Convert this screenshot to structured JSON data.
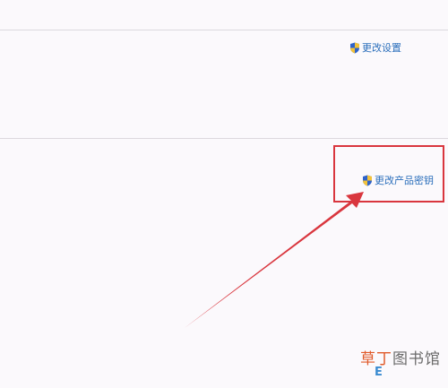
{
  "settings_section": {
    "change_settings_label": "更改设置",
    "icon": "uac-shield-icon"
  },
  "activation_section": {
    "change_product_key_label": "更改产品密钥",
    "icon": "uac-shield-icon"
  },
  "annotation": {
    "highlight_color": "#d9363e",
    "arrow_color": "#d9363e"
  },
  "watermark": {
    "accent_text": "草丁",
    "rest_text": "图书馆",
    "badge_letter": "E"
  },
  "colors": {
    "link": "#2a6ebb",
    "background": "#fbf9fc"
  }
}
